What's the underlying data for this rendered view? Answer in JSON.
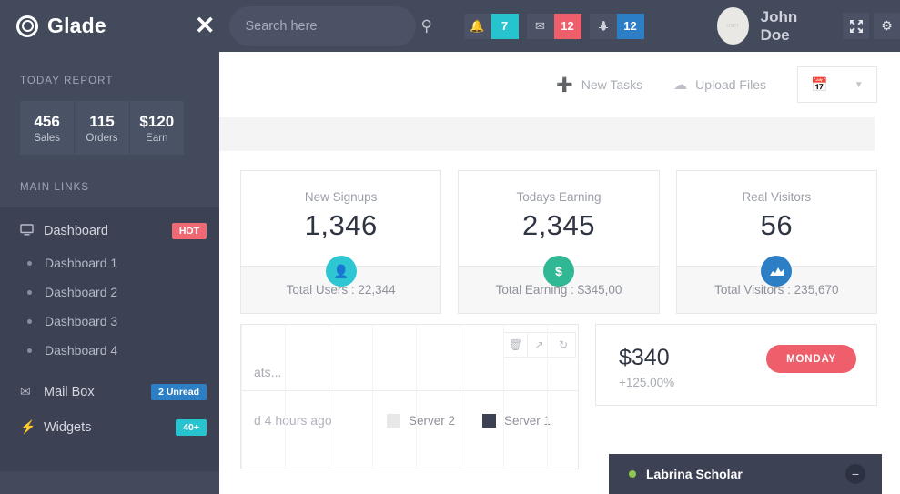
{
  "header": {
    "brand": "Glade",
    "logo_icon": "target-icon",
    "close_icon": "close-icon",
    "search": {
      "placeholder": "Search here",
      "value": "",
      "icon": "search-icon"
    },
    "badges": [
      {
        "icon": "bell-icon",
        "count": "7",
        "color": "#27c4d0"
      },
      {
        "icon": "envelope-icon",
        "count": "12",
        "color": "#ef5f6b"
      },
      {
        "icon": "bug-icon",
        "count": "12",
        "color": "#2c7fc4"
      }
    ],
    "user": {
      "name": "John Doe",
      "avatar_label": "user"
    },
    "actions": [
      {
        "icon": "fullscreen-icon",
        "label": "Fullscreen"
      },
      {
        "icon": "gear-icon",
        "label": "Settings"
      }
    ]
  },
  "sidebar": {
    "today_report_title": "TODAY REPORT",
    "report": [
      {
        "value": "456",
        "label": "Sales"
      },
      {
        "value": "115",
        "label": "Orders"
      },
      {
        "value": "$120",
        "label": "Earn"
      }
    ],
    "main_links_title": "MAIN LINKS",
    "items": [
      {
        "label": "Dashboard",
        "icon": "monitor-icon",
        "badge": "HOT",
        "badge_color": "#ef6975"
      },
      {
        "label": "Dashboard 1",
        "sub": true
      },
      {
        "label": "Dashboard 2",
        "sub": true
      },
      {
        "label": "Dashboard 3",
        "sub": true
      },
      {
        "label": "Dashboard 4",
        "sub": true
      },
      {
        "label": "Mail Box",
        "icon": "envelope-icon",
        "badge": "2 Unread",
        "badge_color": "#2c7fc4"
      },
      {
        "label": "Widgets",
        "icon": "bolt-icon",
        "badge": "40+",
        "badge_color": "#27c4d0"
      }
    ]
  },
  "toolbar": {
    "new_tasks": "New Tasks",
    "new_tasks_icon": "plus-icon",
    "upload_files": "Upload Files",
    "upload_files_icon": "cloud-upload-icon",
    "date_icon": "calendar-icon",
    "date_caret_icon": "chevron-down-icon"
  },
  "cards": [
    {
      "title": "New Signups",
      "value": "1,346",
      "icon": "user-icon",
      "icon_color": "#2ec6d3",
      "footer": "Total Users : 22,344"
    },
    {
      "title": "Todays Earning",
      "value": "2,345",
      "icon": "dollar-icon",
      "icon_color": "#30b894",
      "footer": "Total Earning : $345,00"
    },
    {
      "title": "Real Visitors",
      "value": "56",
      "icon": "area-chart-icon",
      "icon_color": "#2c7fc4",
      "footer": "Total Visitors : 235,670"
    }
  ],
  "chart_panel": {
    "subtitle": "ats...",
    "updated": "d 4 hours ago",
    "tools": [
      {
        "icon": "trash-icon",
        "label": "Delete"
      },
      {
        "icon": "expand-icon",
        "label": "Expand"
      },
      {
        "icon": "refresh-icon",
        "label": "Refresh"
      }
    ],
    "legend": [
      {
        "label": "Server 2",
        "color": "#e8e8ea"
      },
      {
        "label": "Server 1",
        "color": "#3c4254"
      }
    ]
  },
  "money_card": {
    "amount": "$340",
    "percent": "+125.00%",
    "pill": "MONDAY",
    "pill_color": "#ef5f6b"
  },
  "chat": {
    "name": "Labrina Scholar",
    "status_color": "#8fc94e",
    "minimize_icon": "minus-icon"
  }
}
